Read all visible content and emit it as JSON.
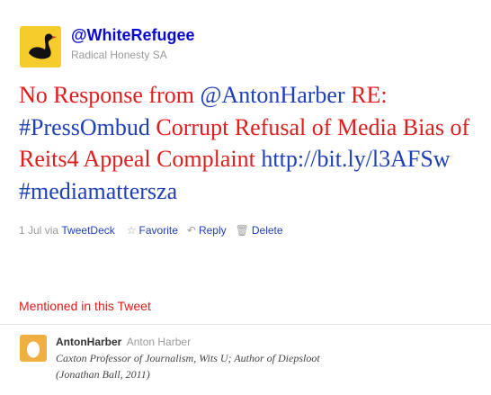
{
  "author": {
    "screen_name": "@WhiteRefugee",
    "full_name": "Radical Honesty SA",
    "avatar_icon": "black-swan-icon",
    "avatar_bg": "#f6cb2c"
  },
  "tweet": {
    "segments": [
      {
        "text": "No Response from ",
        "kind": "text"
      },
      {
        "text": "@AntonHarber",
        "kind": "mention"
      },
      {
        "text": " RE: ",
        "kind": "text"
      },
      {
        "text": "#PressOmbud",
        "kind": "hashtag"
      },
      {
        "text": " Corrupt Refusal of Media Bias of Reits4 Appeal Complaint ",
        "kind": "text"
      },
      {
        "text": "http://bit.ly/l3AFSw",
        "kind": "url"
      },
      {
        "text": " ",
        "kind": "text"
      },
      {
        "text": "#mediamattersza",
        "kind": "hashtag"
      }
    ],
    "text_color": "#de1d1d",
    "link_color": "#1f3fb6"
  },
  "meta": {
    "date": "1 Jul",
    "via": "via",
    "source": "TweetDeck",
    "favorite": "Favorite",
    "reply": "Reply",
    "delete": "Delete"
  },
  "mentioned": {
    "heading": "Mentioned in this Tweet",
    "user": {
      "screen_name": "AntonHarber",
      "full_name": "Anton Harber",
      "bio_line1": "Caxton Professor of Journalism, Wits U; Author of Diepsloot",
      "bio_line2": "(Jonathan Ball, 2011)",
      "avatar_icon": "default-egg-icon",
      "avatar_bg": "#efb041"
    }
  }
}
